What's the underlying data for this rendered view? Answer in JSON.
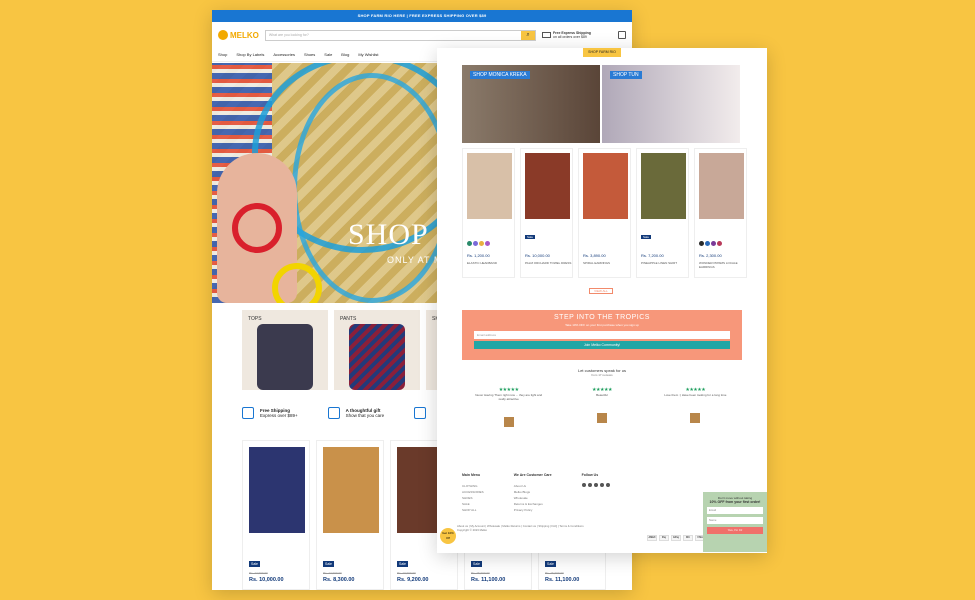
{
  "left_page": {
    "topbar": "SHOP FARM RIO HERE | FREE EXPRESS SHIPPING OVER $89",
    "logo": "MELKO",
    "search_placeholder": "What are you looking for?",
    "shipping_title": "Free Express Shipping",
    "shipping_sub": "on all orders over $89",
    "nav": [
      "Shop",
      "Shop By Labels",
      "Accessories",
      "Shoes",
      "Sale",
      "Blog",
      "My Wishlist"
    ],
    "hero_title": "SHOP M",
    "hero_sub": "ONLY AT M",
    "categories": [
      "TOPS",
      "PANTS",
      "SK"
    ],
    "features": [
      {
        "title": "Free Shipping",
        "sub": "Express over $89+"
      },
      {
        "title": "A thoughtful gift",
        "sub": "Show that you care"
      }
    ],
    "products": [
      {
        "badge": "Sale",
        "old": "Rs. 14,000.00",
        "price": "Rs. 10,000.00"
      },
      {
        "badge": "Sale",
        "old": "Rs. 12,000.00",
        "price": "Rs. 8,300.00"
      },
      {
        "badge": "Sale",
        "old": "Rs. 13,000.00",
        "price": "Rs. 9,200.00"
      },
      {
        "badge": "Sale",
        "old": "Rs. 16,000.00",
        "price": "Rs. 11,100.00"
      },
      {
        "badge": "Sale",
        "old": "Rs. 16,000.00",
        "price": "Rs. 11,100.00"
      }
    ]
  },
  "right_page": {
    "promo_button": "SHOP FARM RIO",
    "banners": [
      "SHOP MONICA KREKA",
      "SHOP TUN"
    ],
    "products": [
      {
        "price": "Rs. 1,200.00",
        "name": "ELASTIC HEADBAND",
        "badge": ""
      },
      {
        "price": "Rs. 10,000.00",
        "name": "PALM ORCHARD TOWEL DRESS",
        "badge": "Sale"
      },
      {
        "price": "Rs. 3,890.00",
        "name": "SPIRAL EARRINGS",
        "badge": ""
      },
      {
        "price": "Rs. 7,200.00",
        "name": "PINEAPPLE LINEN SHIRT",
        "badge": "Sale"
      },
      {
        "price": "Rs. 2,300.00",
        "name": "WONDER PRISMS LOCALE EARRINGS",
        "badge": ""
      }
    ],
    "view_all": "VIEW ALL",
    "tropics_title": "STEP INTO THE TROPICS",
    "tropics_text": "Take 10% OFF on your first purchase when you sign up",
    "email_placeholder": "Email address",
    "join_button": "Join Melko Community!",
    "reviews_title": "Let customers speak for us",
    "reviews_sub": "from 17 reviews",
    "reviews": [
      {
        "stars": "★★★★★",
        "text": "Never Having Them right now ... they are light and really attractive"
      },
      {
        "stars": "★★★★★",
        "text": "Beautiful"
      },
      {
        "stars": "★★★★★",
        "text": "Love them :) Have been looking for a long time"
      }
    ],
    "footer": {
      "col1_title": "Main Menu",
      "col1": [
        "CLOTHING",
        "ACCESSORIES",
        "SHOES",
        "SALE",
        "SHOP ALL"
      ],
      "col2_title": "We Are Customer Care",
      "col2": [
        "About Us",
        "Melko Blogs",
        "Wholesale",
        "Returns & Exchanges",
        "Privacy Policy"
      ],
      "col3_title": "Follow Us"
    },
    "footer_links": "About us | My Account | Wholesale | Melko Returns | Contact us | Shipping | FAQ | Terms & Conditions",
    "copyright": "Copyright © 2023 Melko",
    "payments": [
      "AMEX",
      "Pay",
      "GPay",
      "MC",
      "VISA"
    ],
    "offer_badge": "Get 10% Off",
    "popup": {
      "text1": "Don't move without taking",
      "bold": "10% OFF from your first order!",
      "email": "Email",
      "name": "Name",
      "button": "Yes, I'm In!"
    }
  }
}
